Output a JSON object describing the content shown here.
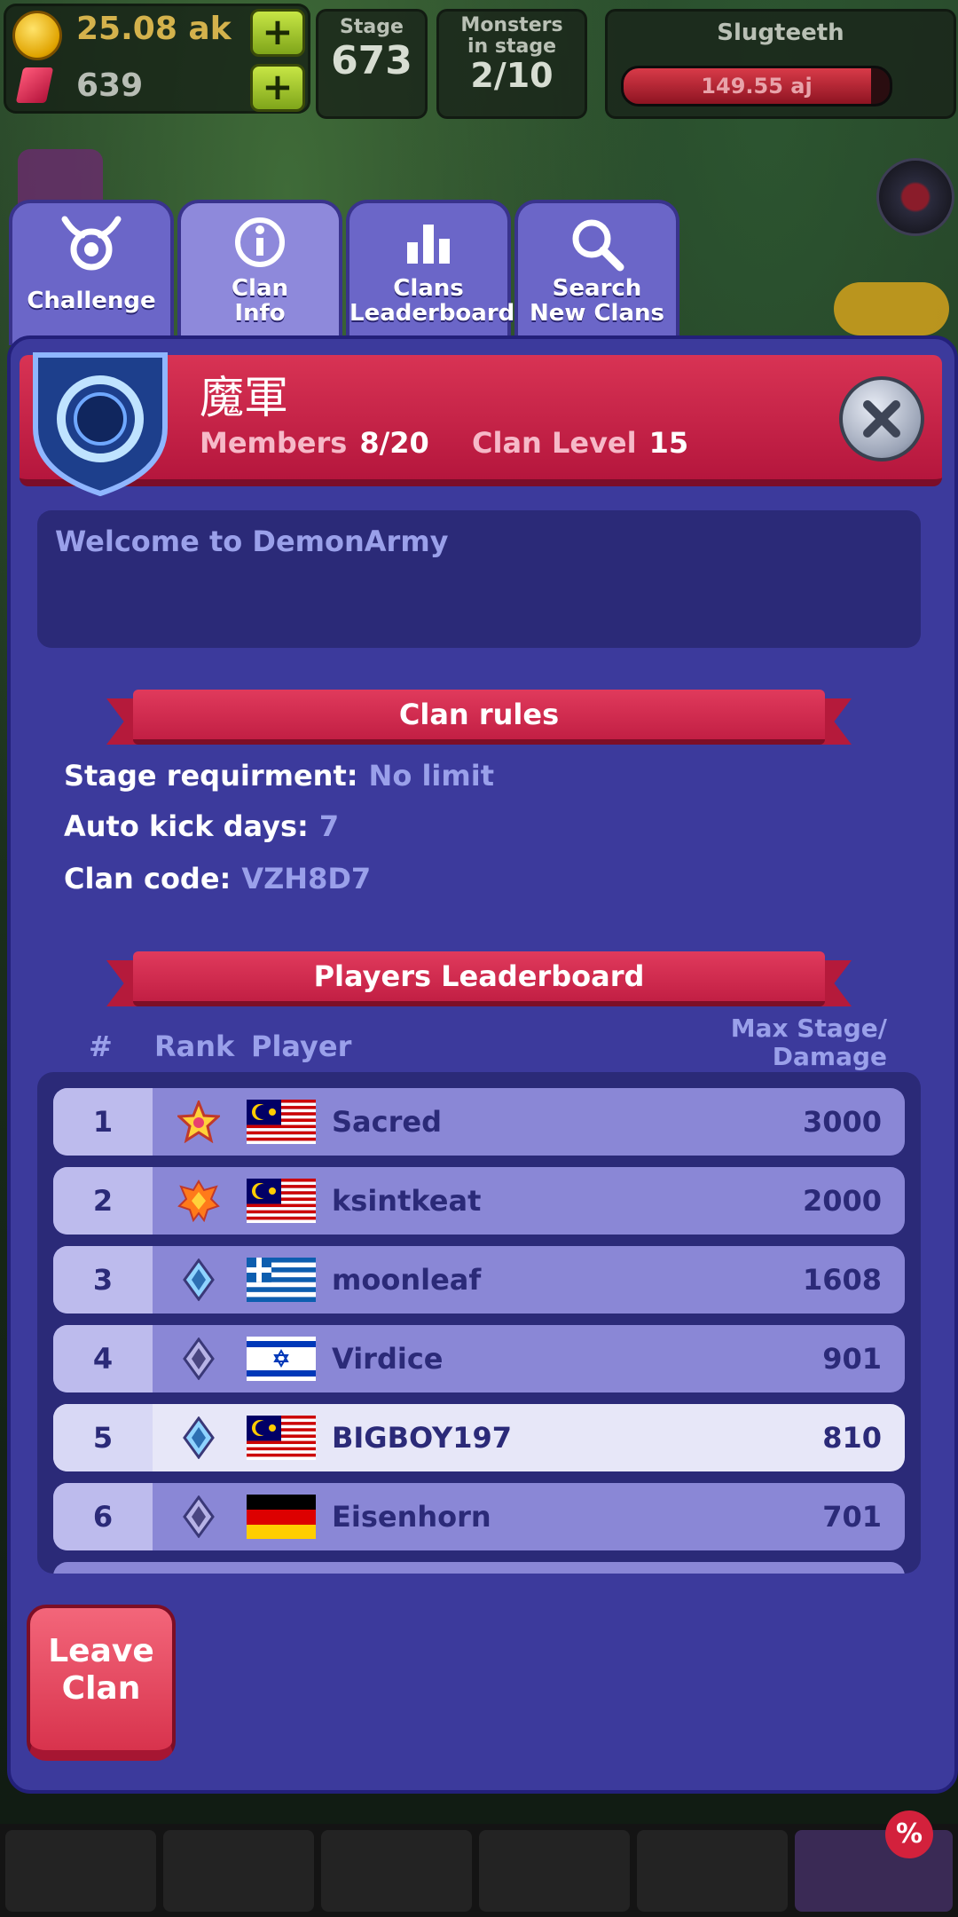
{
  "hud": {
    "gold": "25.08 ak",
    "gems": "639",
    "stage_label": "Stage",
    "stage_value": "673",
    "monsters_label_1": "Monsters",
    "monsters_label_2": "in stage",
    "monsters_value": "2/10",
    "boss_name": "Slugteeth",
    "boss_hp": "149.55 aj",
    "boss_hp_fraction": 0.93
  },
  "tabs": [
    {
      "label_1": "Challenge",
      "label_2": ""
    },
    {
      "label_1": "Clan",
      "label_2": "Info"
    },
    {
      "label_1": "Clans",
      "label_2": "Leaderboard"
    },
    {
      "label_1": "Search",
      "label_2": "New Clans"
    }
  ],
  "clan": {
    "name": "魔軍",
    "members_label": "Members",
    "members_value": "8/20",
    "level_label": "Clan Level",
    "level_value": "15",
    "welcome": "Welcome to DemonArmy"
  },
  "rules": {
    "title": "Clan rules",
    "stage_label": "Stage requirment:",
    "stage_value": "No limit",
    "kick_label": "Auto kick days:",
    "kick_value": "7",
    "code_label": "Clan code:",
    "code_value": "VZH8D7"
  },
  "leaderboard": {
    "title": "Players Leaderboard",
    "col_num": "#",
    "col_rank": "Rank",
    "col_player": "Player",
    "col_score_1": "Max Stage/",
    "col_score_2": "Damage",
    "rows": [
      {
        "num": "1",
        "name": "Sacred",
        "score": "3000",
        "flag": "malaysia",
        "rank_icon": "gold-star-icon"
      },
      {
        "num": "2",
        "name": "ksintkeat",
        "score": "2000",
        "flag": "malaysia",
        "rank_icon": "orange-emblem-icon"
      },
      {
        "num": "3",
        "name": "moonleaf",
        "score": "1608",
        "flag": "greece",
        "rank_icon": "blue-diamond-icon"
      },
      {
        "num": "4",
        "name": "Virdice",
        "score": "901",
        "flag": "israel",
        "rank_icon": "purple-diamond-icon"
      },
      {
        "num": "5",
        "name": "BIGBOY197",
        "score": "810",
        "flag": "malaysia",
        "rank_icon": "blue-diamond-icon"
      },
      {
        "num": "6",
        "name": "Eisenhorn",
        "score": "701",
        "flag": "germany",
        "rank_icon": "purple-diamond-icon"
      }
    ]
  },
  "leave_label_1": "Leave",
  "leave_label_2": "Clan",
  "shop_badge": "%",
  "colors": {
    "panel": "#3c3a9c",
    "banner": "#c8244a",
    "accent_text": "#9aa0ea"
  }
}
